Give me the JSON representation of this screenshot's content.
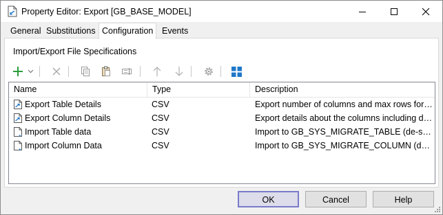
{
  "window": {
    "title": "Property Editor: Export [GB_BASE_MODEL]",
    "controls": [
      "minimize",
      "maximize",
      "close"
    ]
  },
  "tabs": [
    {
      "label": "General",
      "active": false
    },
    {
      "label": "Substitutions",
      "active": false
    },
    {
      "label": "Configuration",
      "active": true
    },
    {
      "label": "Events",
      "active": false
    }
  ],
  "panel": {
    "title": "Import/Export File Specifications"
  },
  "toolbar": {
    "icons": [
      "add-icon",
      "dropdown-arrow-icon",
      "delete-icon",
      "copy-icon",
      "paste-icon",
      "rename-icon",
      "move-up-icon",
      "move-down-icon",
      "settings-icon",
      "grid-view-icon"
    ]
  },
  "table": {
    "columns": [
      "Name",
      "Type",
      "Description"
    ],
    "rows": [
      {
        "icon": "export-file-icon",
        "name": "Export Table Details",
        "type": "CSV",
        "description": "Export number of columns and max rows for a..."
      },
      {
        "icon": "export-file-icon",
        "name": "Export Column Details",
        "type": "CSV",
        "description": "Export details about the columns including dat..."
      },
      {
        "icon": "import-file-icon",
        "name": "Import Table data",
        "type": "CSV",
        "description": "Import to GB_SYS_MIGRATE_TABLE (de-select if..."
      },
      {
        "icon": "import-file-icon",
        "name": "Import Column Data",
        "type": "CSV",
        "description": "Import to GB_SYS_MIGRATE_COLUMN (de-sele..."
      }
    ]
  },
  "buttons": {
    "ok": "OK",
    "cancel": "Cancel",
    "help": "Help"
  },
  "colors": {
    "accent": "#2a9d3c",
    "grid_icon": "#1e78c8",
    "default_button_border": "#7a7acb"
  }
}
